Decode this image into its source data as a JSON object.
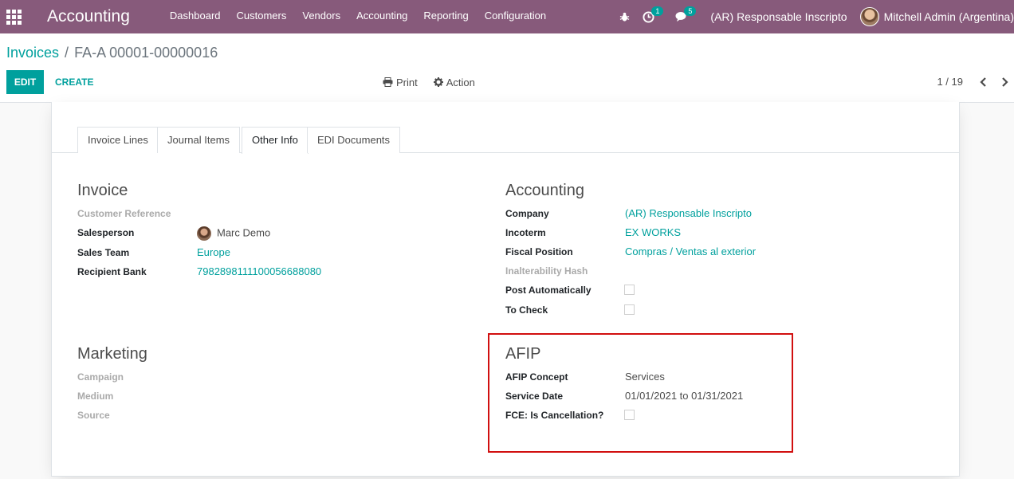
{
  "navbar": {
    "app_title": "Accounting",
    "menu": [
      "Dashboard",
      "Customers",
      "Vendors",
      "Accounting",
      "Reporting",
      "Configuration"
    ],
    "activity_count": "1",
    "message_count": "5",
    "company": "(AR) Responsable Inscripto",
    "user": "Mitchell Admin (Argentina)"
  },
  "breadcrumb": {
    "parent": "Invoices",
    "separator": "/",
    "current": "FA-A 00001-00000016"
  },
  "buttons": {
    "edit": "EDIT",
    "create": "CREATE",
    "print": "Print",
    "action": "Action"
  },
  "pager": {
    "value": "1 / 19"
  },
  "tabs": [
    "Invoice Lines",
    "Journal Items",
    "Other Info",
    "EDI Documents"
  ],
  "active_tab": "Other Info",
  "invoice_group": {
    "title": "Invoice",
    "customer_reference_label": "Customer Reference",
    "salesperson_label": "Salesperson",
    "salesperson_value": "Marc Demo",
    "sales_team_label": "Sales Team",
    "sales_team_value": "Europe",
    "recipient_bank_label": "Recipient Bank",
    "recipient_bank_value": "7982898111100056688080"
  },
  "accounting_group": {
    "title": "Accounting",
    "company_label": "Company",
    "company_value": "(AR) Responsable Inscripto",
    "incoterm_label": "Incoterm",
    "incoterm_value": "EX WORKS",
    "fiscal_position_label": "Fiscal Position",
    "fiscal_position_value": "Compras / Ventas al exterior",
    "inalterability_label": "Inalterability Hash",
    "post_auto_label": "Post Automatically",
    "to_check_label": "To Check"
  },
  "marketing_group": {
    "title": "Marketing",
    "campaign_label": "Campaign",
    "medium_label": "Medium",
    "source_label": "Source"
  },
  "afip_group": {
    "title": "AFIP",
    "concept_label": "AFIP Concept",
    "concept_value": "Services",
    "service_date_label": "Service Date",
    "service_date_value": "01/01/2021 to 01/31/2021",
    "fce_label": "FCE: Is Cancellation?"
  },
  "colors": {
    "navbar": "#875a7b",
    "accent": "#00a09d",
    "highlight_border": "#d10f0f"
  }
}
